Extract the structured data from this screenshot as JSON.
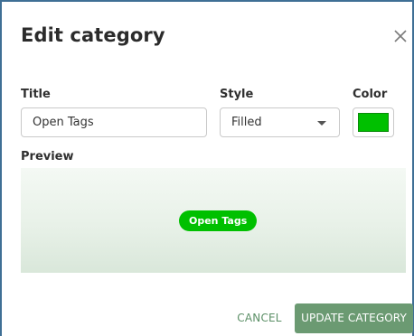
{
  "dialog": {
    "title": "Edit category",
    "close_icon": "close-icon"
  },
  "form": {
    "title_label": "Title",
    "title_value": "Open Tags",
    "style_label": "Style",
    "style_value": "Filled",
    "color_label": "Color",
    "color_value": "#00c000"
  },
  "preview": {
    "label": "Preview",
    "tag_text": "Open Tags",
    "tag_color": "#00c000"
  },
  "actions": {
    "cancel_label": "CANCEL",
    "update_label": "UPDATE CATEGORY"
  },
  "colors": {
    "accent": "#6b9a72",
    "cancel_text": "#5b8f66",
    "frame_border": "#3f6f95"
  }
}
